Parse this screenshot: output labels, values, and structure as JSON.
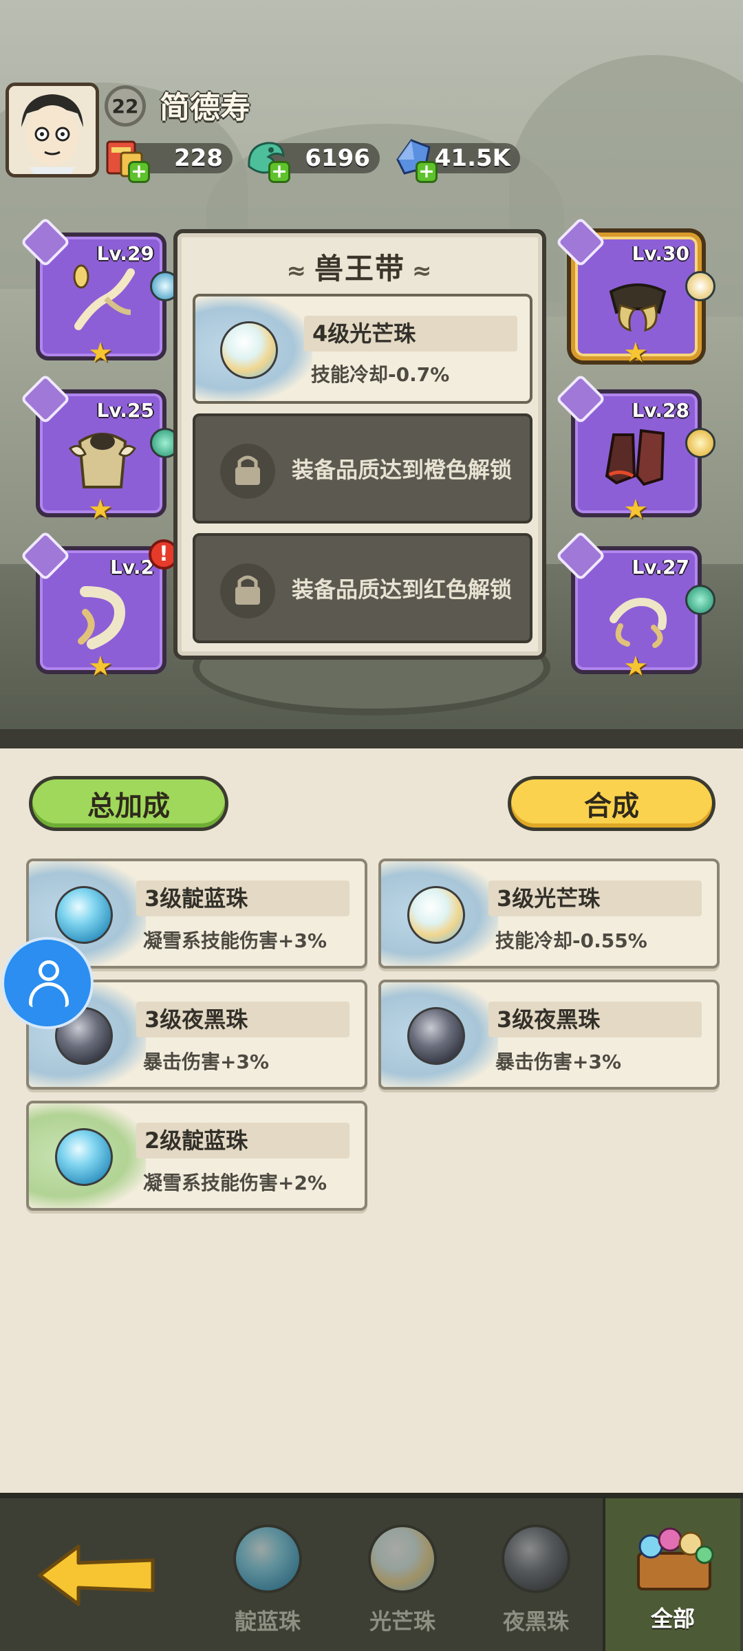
{
  "player": {
    "level": "22",
    "name": "简德寿"
  },
  "resources": [
    {
      "icon": "scroll-ticket-icon",
      "value": "228"
    },
    {
      "icon": "jade-dragon-icon",
      "value": "6196"
    },
    {
      "icon": "blue-crystal-icon",
      "value": "41.5K"
    }
  ],
  "equipment": {
    "left": [
      {
        "slot": "weapon",
        "level": "Lv.29",
        "icon": "whip-weapon-icon"
      },
      {
        "slot": "armor",
        "level": "Lv.25",
        "icon": "armor-chest-icon"
      },
      {
        "slot": "accessory",
        "level": "Lv.2",
        "icon": "horn-accessory-icon",
        "alert": "!"
      }
    ],
    "right": [
      {
        "slot": "belt",
        "level": "Lv.30",
        "icon": "beast-belt-icon",
        "selected": true
      },
      {
        "slot": "boots",
        "level": "Lv.28",
        "icon": "boots-icon"
      },
      {
        "slot": "ring",
        "level": "Lv.27",
        "icon": "claw-ring-icon"
      }
    ]
  },
  "detail_panel": {
    "title": "兽王带",
    "slots": [
      {
        "name": "4级光芒珠",
        "effect": "技能冷却-0.7%"
      },
      {
        "locked_text": "装备品质达到橙色解锁"
      },
      {
        "locked_text": "装备品质达到红色解锁"
      }
    ]
  },
  "buttons": {
    "total_bonus": "总加成",
    "merge": "合成"
  },
  "pearls": [
    {
      "name": "3级靛蓝珠",
      "effect": "凝雪系技能伤害+3%",
      "orb": "blue"
    },
    {
      "name": "3级光芒珠",
      "effect": "技能冷却-0.55%",
      "orb": "light"
    },
    {
      "name": "3级夜黑珠",
      "effect": "暴击伤害+3%",
      "orb": "dark"
    },
    {
      "name": "3级夜黑珠",
      "effect": "暴击伤害+3%",
      "orb": "dark"
    },
    {
      "name": "2级靛蓝珠",
      "effect": "凝雪系技能伤害+2%",
      "orb": "blue"
    }
  ],
  "tabs": [
    {
      "label": "靛蓝珠"
    },
    {
      "label": "光芒珠"
    },
    {
      "label": "夜黑珠"
    },
    {
      "label": "全部"
    }
  ]
}
